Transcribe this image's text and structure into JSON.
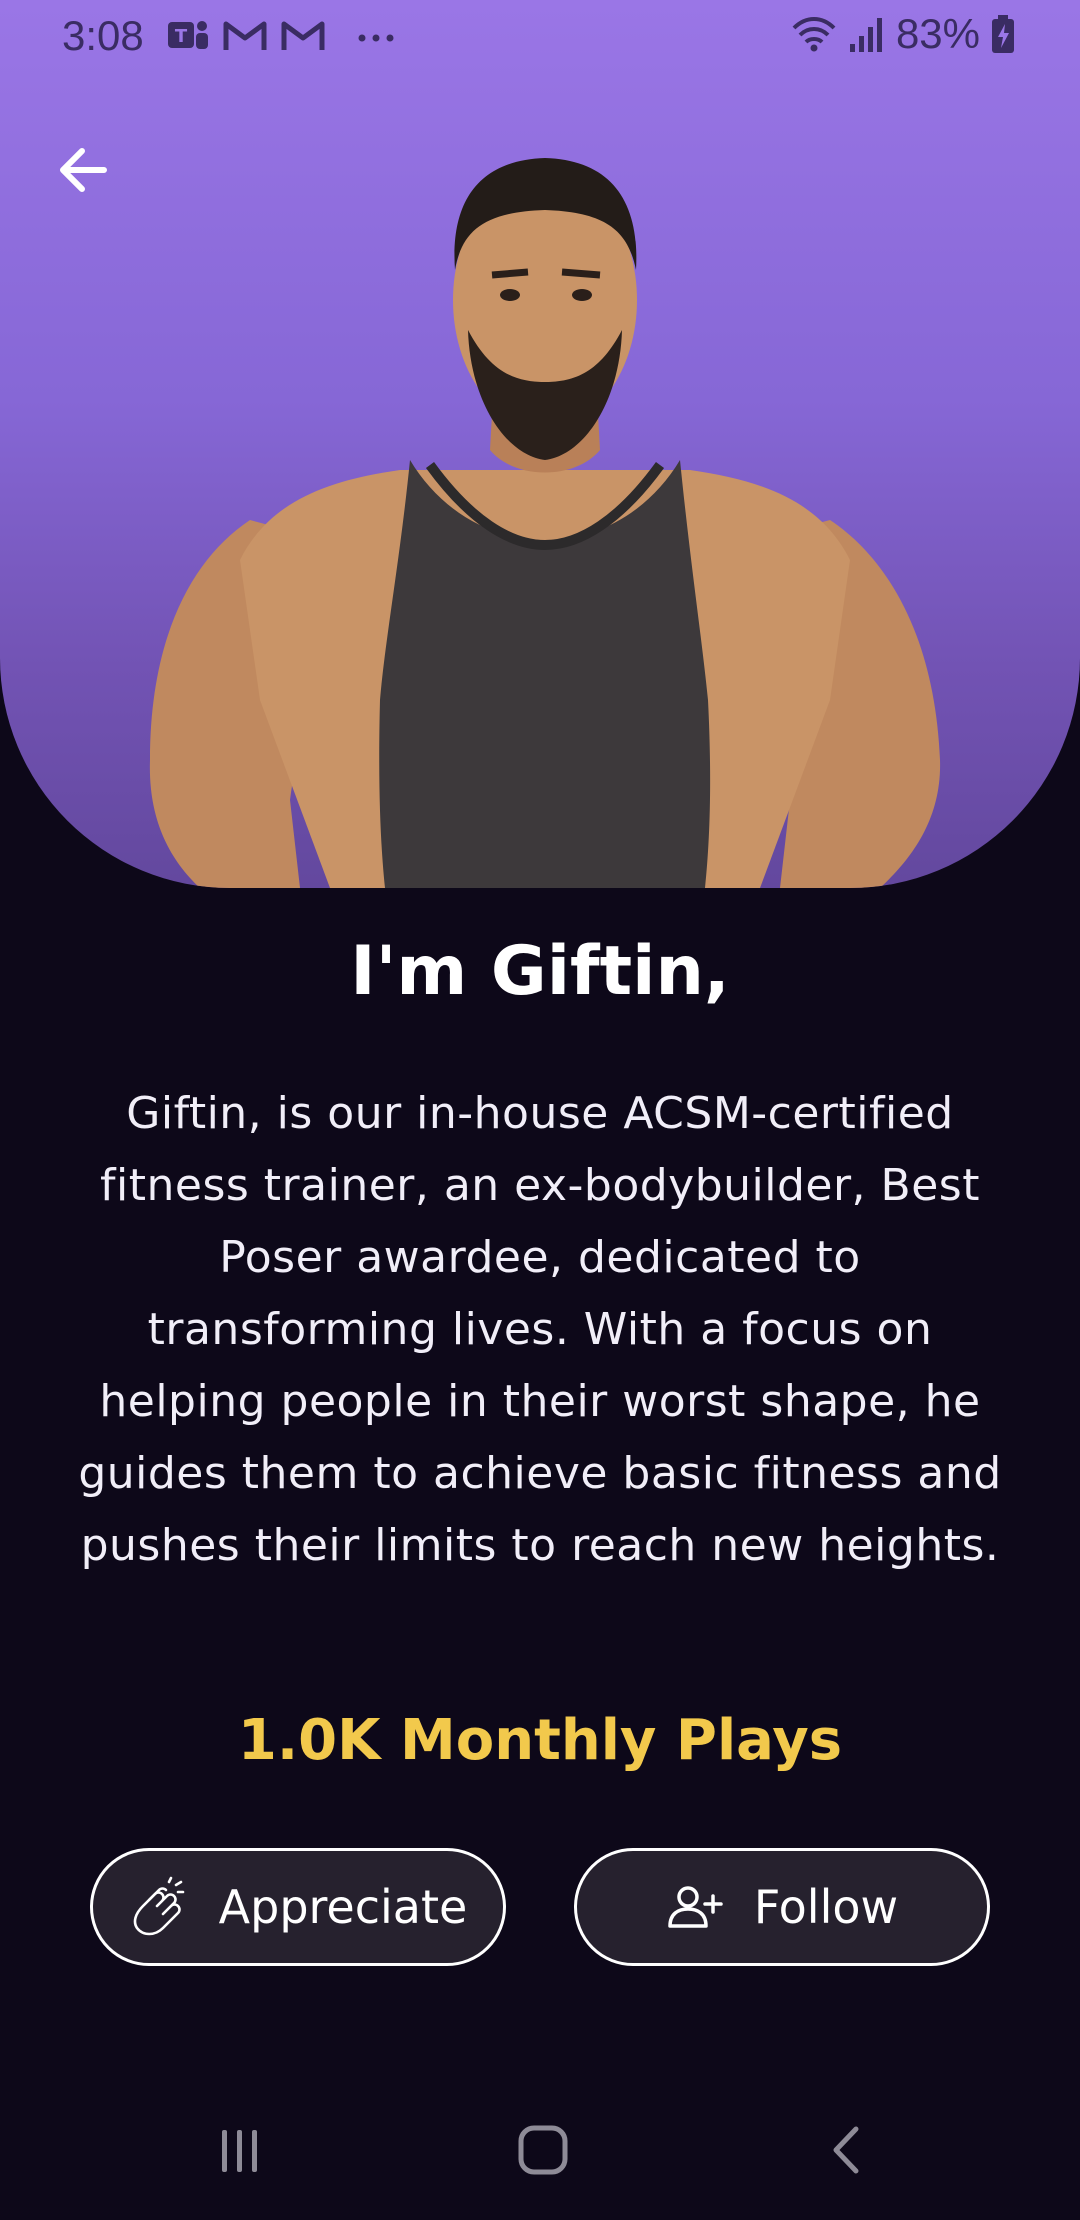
{
  "status_bar": {
    "time": "3:08",
    "battery": "83%",
    "left_icons": [
      "teams-icon",
      "gmail-icon",
      "gmail-icon",
      "more-dots-icon"
    ],
    "right_icons": [
      "wifi-icon",
      "signal-icon",
      "battery-charging-icon"
    ]
  },
  "trainer": {
    "name_heading": "I'm Giftin,",
    "bio": "Giftin, is our in-house ACSM-certified fitness trainer, an ex-bodybuilder, Best Poser awardee, dedicated to transforming lives. With a focus on helping people in their worst shape, he guides them to achieve basic fitness and pushes their limits to reach new heights.",
    "monthly_plays": "1.0K Monthly Plays"
  },
  "actions": {
    "appreciate_label": "Appreciate",
    "follow_label": "Follow"
  },
  "colors": {
    "hero_top": "#9a76e6",
    "hero_bottom": "#63489e",
    "background": "#0d0819",
    "plays_accent": "#f2c94c",
    "button_bg": "#26212e"
  }
}
